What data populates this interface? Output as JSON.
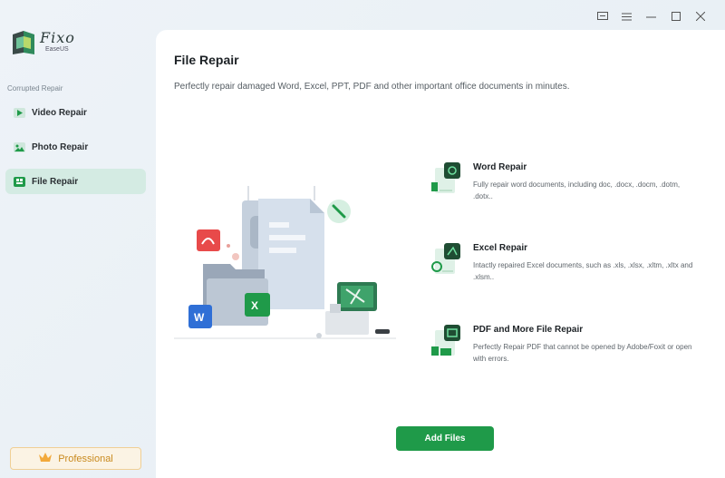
{
  "app": {
    "logo_name": "Fixo",
    "logo_sub": "EaseUS"
  },
  "window_controls": [
    "feedback-icon",
    "menu-icon",
    "minimize-icon",
    "maximize-icon",
    "close-icon"
  ],
  "sidebar": {
    "section_label": "Corrupted Repair",
    "items": [
      {
        "label": "Video Repair",
        "icon": "video-icon",
        "active": false
      },
      {
        "label": "Photo Repair",
        "icon": "photo-icon",
        "active": false
      },
      {
        "label": "File Repair",
        "icon": "file-icon",
        "active": true
      }
    ],
    "pro_label": "Professional"
  },
  "main": {
    "title": "File Repair",
    "subtitle": "Perfectly repair damaged Word, Excel, PPT, PDF and other important office documents in minutes.",
    "features": [
      {
        "title": "Word Repair",
        "desc": "Fully repair word documents, including doc, .docx, .docm, .dotm, .dotx..",
        "icon": "word-doc-icon"
      },
      {
        "title": "Excel Repair",
        "desc": "Intactly repaired Excel documents, such as .xls, .xlsx, .xltm, .xltx and .xlsm..",
        "icon": "excel-doc-icon"
      },
      {
        "title": "PDF and More File Repair",
        "desc": "Perfectly Repair PDF that cannot be opened by Adobe/Foxit or open with errors.",
        "icon": "pdf-doc-icon"
      }
    ],
    "add_button": "Add Files"
  },
  "colors": {
    "accent": "#1f9a49",
    "active_nav": "#d4ebe3",
    "pro": "#c98a1e"
  }
}
